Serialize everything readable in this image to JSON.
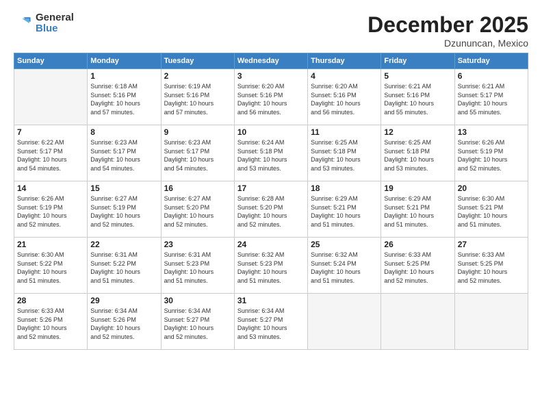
{
  "header": {
    "logo": {
      "line1": "General",
      "line2": "Blue"
    },
    "title": "December 2025",
    "location": "Dzununcan, Mexico"
  },
  "weekdays": [
    "Sunday",
    "Monday",
    "Tuesday",
    "Wednesday",
    "Thursday",
    "Friday",
    "Saturday"
  ],
  "weeks": [
    [
      {
        "day": "",
        "info": ""
      },
      {
        "day": "1",
        "info": "Sunrise: 6:18 AM\nSunset: 5:16 PM\nDaylight: 10 hours\nand 57 minutes."
      },
      {
        "day": "2",
        "info": "Sunrise: 6:19 AM\nSunset: 5:16 PM\nDaylight: 10 hours\nand 57 minutes."
      },
      {
        "day": "3",
        "info": "Sunrise: 6:20 AM\nSunset: 5:16 PM\nDaylight: 10 hours\nand 56 minutes."
      },
      {
        "day": "4",
        "info": "Sunrise: 6:20 AM\nSunset: 5:16 PM\nDaylight: 10 hours\nand 56 minutes."
      },
      {
        "day": "5",
        "info": "Sunrise: 6:21 AM\nSunset: 5:16 PM\nDaylight: 10 hours\nand 55 minutes."
      },
      {
        "day": "6",
        "info": "Sunrise: 6:21 AM\nSunset: 5:17 PM\nDaylight: 10 hours\nand 55 minutes."
      }
    ],
    [
      {
        "day": "7",
        "info": "Sunrise: 6:22 AM\nSunset: 5:17 PM\nDaylight: 10 hours\nand 54 minutes."
      },
      {
        "day": "8",
        "info": "Sunrise: 6:23 AM\nSunset: 5:17 PM\nDaylight: 10 hours\nand 54 minutes."
      },
      {
        "day": "9",
        "info": "Sunrise: 6:23 AM\nSunset: 5:17 PM\nDaylight: 10 hours\nand 54 minutes."
      },
      {
        "day": "10",
        "info": "Sunrise: 6:24 AM\nSunset: 5:18 PM\nDaylight: 10 hours\nand 53 minutes."
      },
      {
        "day": "11",
        "info": "Sunrise: 6:25 AM\nSunset: 5:18 PM\nDaylight: 10 hours\nand 53 minutes."
      },
      {
        "day": "12",
        "info": "Sunrise: 6:25 AM\nSunset: 5:18 PM\nDaylight: 10 hours\nand 53 minutes."
      },
      {
        "day": "13",
        "info": "Sunrise: 6:26 AM\nSunset: 5:19 PM\nDaylight: 10 hours\nand 52 minutes."
      }
    ],
    [
      {
        "day": "14",
        "info": "Sunrise: 6:26 AM\nSunset: 5:19 PM\nDaylight: 10 hours\nand 52 minutes."
      },
      {
        "day": "15",
        "info": "Sunrise: 6:27 AM\nSunset: 5:19 PM\nDaylight: 10 hours\nand 52 minutes."
      },
      {
        "day": "16",
        "info": "Sunrise: 6:27 AM\nSunset: 5:20 PM\nDaylight: 10 hours\nand 52 minutes."
      },
      {
        "day": "17",
        "info": "Sunrise: 6:28 AM\nSunset: 5:20 PM\nDaylight: 10 hours\nand 52 minutes."
      },
      {
        "day": "18",
        "info": "Sunrise: 6:29 AM\nSunset: 5:21 PM\nDaylight: 10 hours\nand 51 minutes."
      },
      {
        "day": "19",
        "info": "Sunrise: 6:29 AM\nSunset: 5:21 PM\nDaylight: 10 hours\nand 51 minutes."
      },
      {
        "day": "20",
        "info": "Sunrise: 6:30 AM\nSunset: 5:21 PM\nDaylight: 10 hours\nand 51 minutes."
      }
    ],
    [
      {
        "day": "21",
        "info": "Sunrise: 6:30 AM\nSunset: 5:22 PM\nDaylight: 10 hours\nand 51 minutes."
      },
      {
        "day": "22",
        "info": "Sunrise: 6:31 AM\nSunset: 5:22 PM\nDaylight: 10 hours\nand 51 minutes."
      },
      {
        "day": "23",
        "info": "Sunrise: 6:31 AM\nSunset: 5:23 PM\nDaylight: 10 hours\nand 51 minutes."
      },
      {
        "day": "24",
        "info": "Sunrise: 6:32 AM\nSunset: 5:23 PM\nDaylight: 10 hours\nand 51 minutes."
      },
      {
        "day": "25",
        "info": "Sunrise: 6:32 AM\nSunset: 5:24 PM\nDaylight: 10 hours\nand 51 minutes."
      },
      {
        "day": "26",
        "info": "Sunrise: 6:33 AM\nSunset: 5:25 PM\nDaylight: 10 hours\nand 52 minutes."
      },
      {
        "day": "27",
        "info": "Sunrise: 6:33 AM\nSunset: 5:25 PM\nDaylight: 10 hours\nand 52 minutes."
      }
    ],
    [
      {
        "day": "28",
        "info": "Sunrise: 6:33 AM\nSunset: 5:26 PM\nDaylight: 10 hours\nand 52 minutes."
      },
      {
        "day": "29",
        "info": "Sunrise: 6:34 AM\nSunset: 5:26 PM\nDaylight: 10 hours\nand 52 minutes."
      },
      {
        "day": "30",
        "info": "Sunrise: 6:34 AM\nSunset: 5:27 PM\nDaylight: 10 hours\nand 52 minutes."
      },
      {
        "day": "31",
        "info": "Sunrise: 6:34 AM\nSunset: 5:27 PM\nDaylight: 10 hours\nand 53 minutes."
      },
      {
        "day": "",
        "info": ""
      },
      {
        "day": "",
        "info": ""
      },
      {
        "day": "",
        "info": ""
      }
    ]
  ]
}
